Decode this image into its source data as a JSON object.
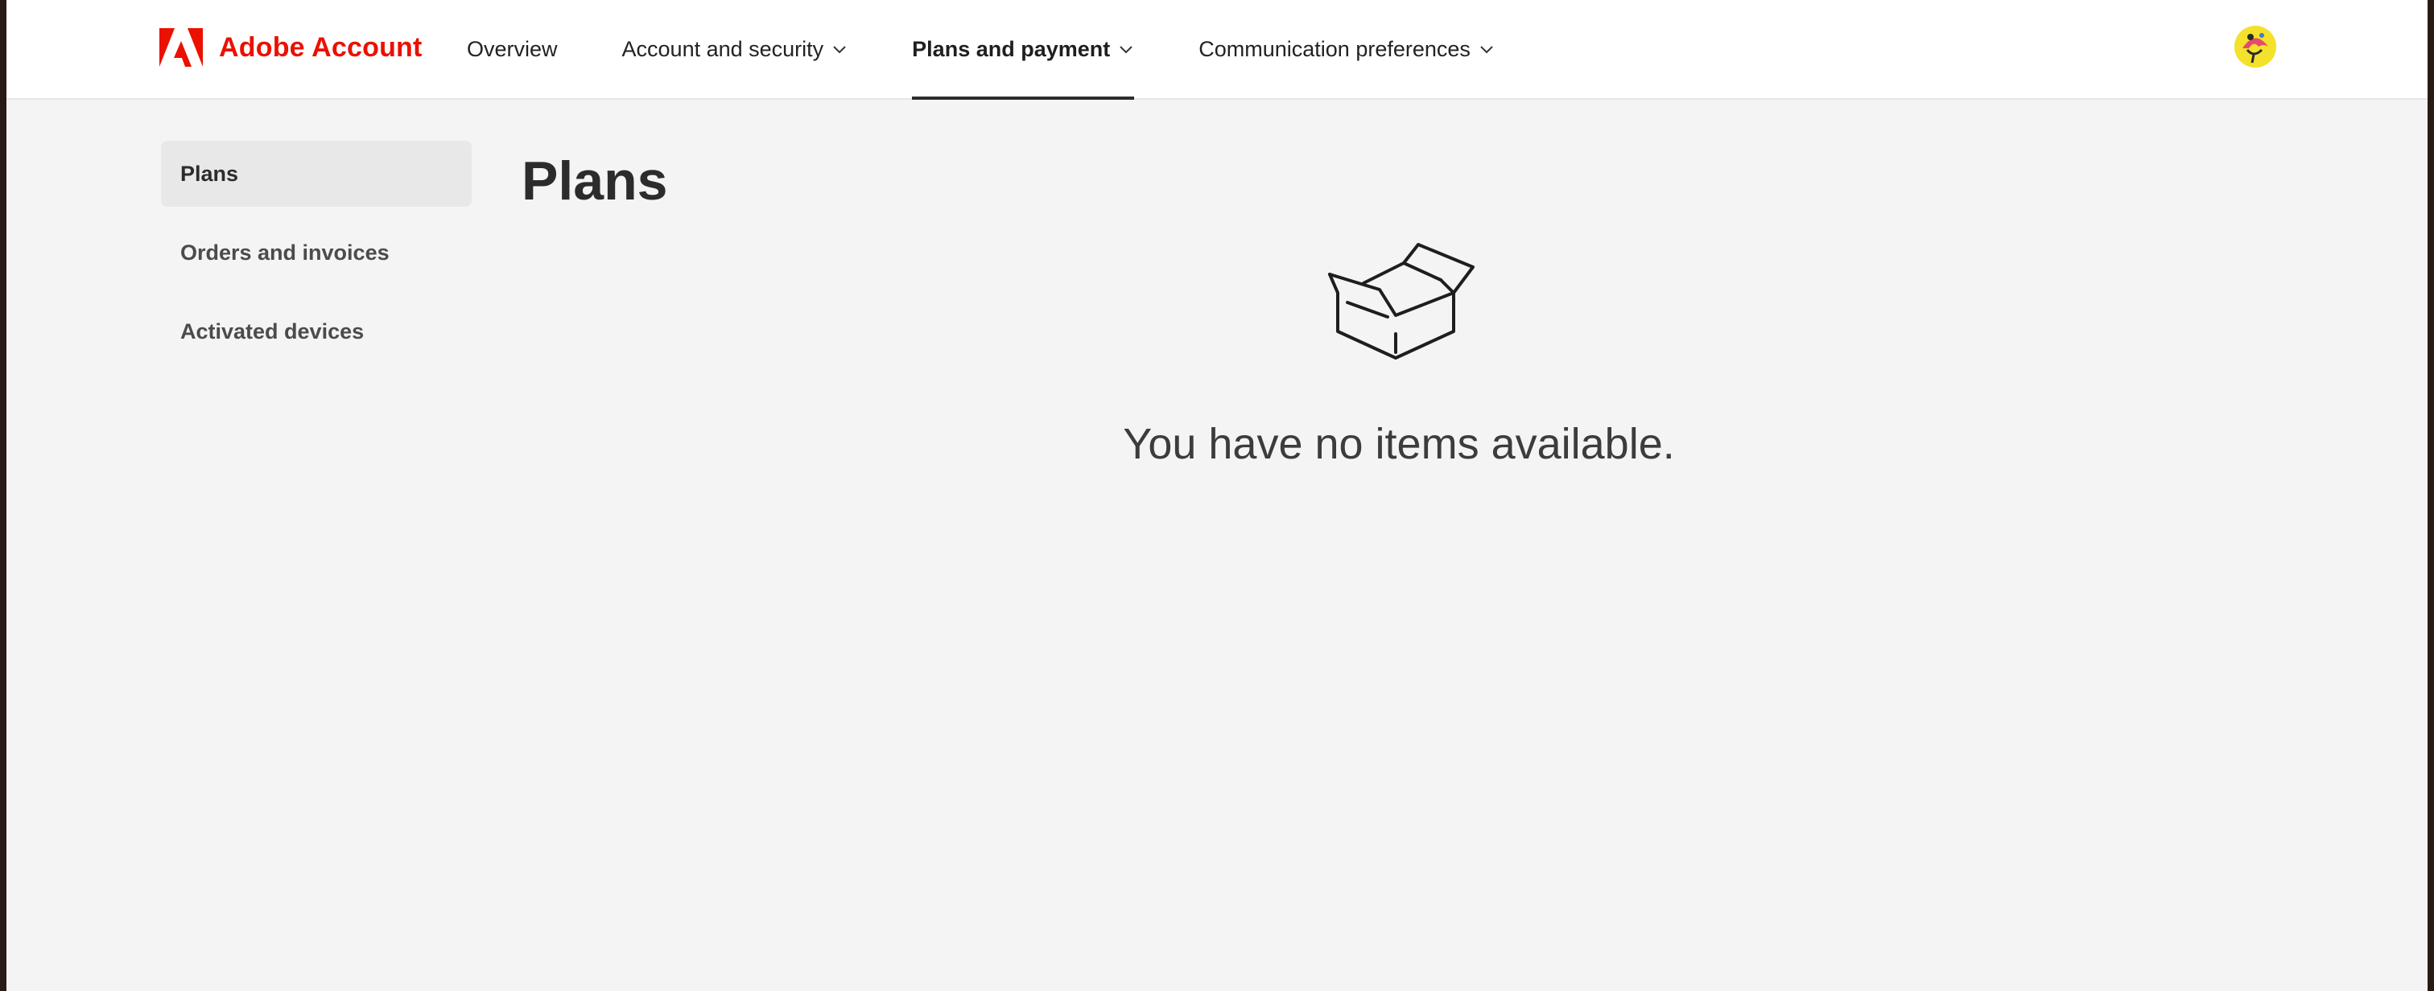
{
  "header": {
    "brand_label": "Adobe Account",
    "brand_color": "#eb1000",
    "brand_icon": "adobe-logo-icon",
    "nav_items": [
      {
        "label": "Overview",
        "has_dropdown": false,
        "active": false
      },
      {
        "label": "Account and security",
        "has_dropdown": true,
        "active": false
      },
      {
        "label": "Plans and payment",
        "has_dropdown": true,
        "active": true
      },
      {
        "label": "Communication preferences",
        "has_dropdown": true,
        "active": false
      }
    ],
    "avatar_icon": "user-avatar"
  },
  "sidebar": {
    "items": [
      {
        "label": "Plans",
        "active": true
      },
      {
        "label": "Orders and invoices",
        "active": false
      },
      {
        "label": "Activated devices",
        "active": false
      }
    ]
  },
  "main": {
    "title": "Plans",
    "empty_state": {
      "icon": "open-box-icon",
      "message": "You have no items available."
    }
  },
  "colors": {
    "page_background": "#f4f4f4",
    "header_background": "#ffffff",
    "active_underline": "#2c2c2c",
    "sidebar_active_background": "#e8e8e8"
  }
}
